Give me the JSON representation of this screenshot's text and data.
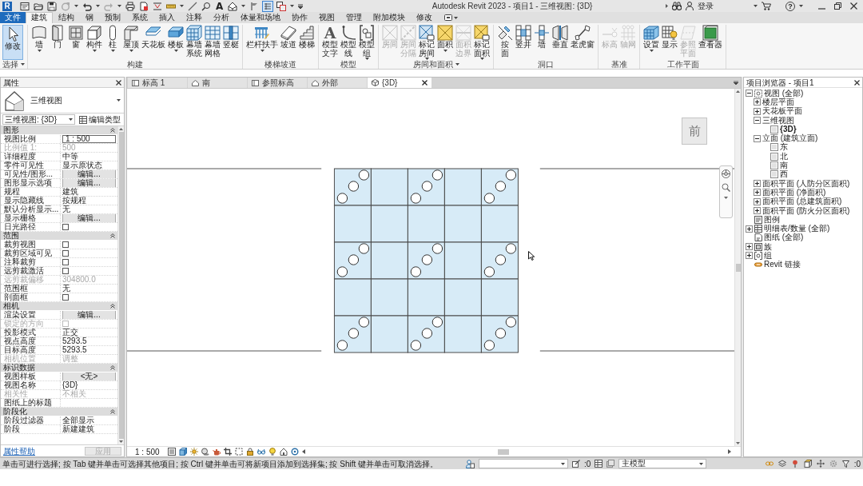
{
  "title_bar": {
    "logo": "R",
    "text_tool": "A",
    "toggle_on": true,
    "title": "Autodesk Revit 2023 - 项目1 - 三维视图: {3D}",
    "user": "登录",
    "help": "?"
  },
  "menu_tabs": [
    {
      "label": "文件",
      "kind": "file",
      "selected": false
    },
    {
      "label": "建筑",
      "kind": "tab",
      "selected": true
    },
    {
      "label": "结构",
      "kind": "tab",
      "selected": false
    },
    {
      "label": "钢",
      "kind": "tab",
      "selected": false
    },
    {
      "label": "预制",
      "kind": "tab",
      "selected": false
    },
    {
      "label": "系统",
      "kind": "tab",
      "selected": false
    },
    {
      "label": "插入",
      "kind": "tab",
      "selected": false
    },
    {
      "label": "注释",
      "kind": "tab",
      "selected": false
    },
    {
      "label": "分析",
      "kind": "tab",
      "selected": false
    },
    {
      "label": "体量和场地",
      "kind": "tab",
      "selected": false
    },
    {
      "label": "协作",
      "kind": "tab",
      "selected": false
    },
    {
      "label": "视图",
      "kind": "tab",
      "selected": false
    },
    {
      "label": "管理",
      "kind": "tab",
      "selected": false
    },
    {
      "label": "附加模块",
      "kind": "tab",
      "selected": false
    },
    {
      "label": "修改",
      "kind": "tab",
      "selected": false
    }
  ],
  "ribbon_groups": [
    {
      "label": "选择",
      "dropdown": true,
      "buttons": [
        {
          "label": "修改",
          "selected": true,
          "disabled": false,
          "dropdown": false
        }
      ]
    },
    {
      "label": "构建",
      "dropdown": false,
      "buttons": [
        {
          "label": "墙",
          "disabled": false,
          "dropdown": true
        },
        {
          "label": "门",
          "disabled": false,
          "dropdown": false
        },
        {
          "label": "窗",
          "disabled": false,
          "dropdown": false
        },
        {
          "label": "构件",
          "disabled": false,
          "dropdown": true
        },
        {
          "label": "柱",
          "disabled": false,
          "dropdown": true
        },
        {
          "label": "屋顶",
          "disabled": false,
          "dropdown": true
        },
        {
          "label": "天花板",
          "disabled": false,
          "dropdown": false
        },
        {
          "label": "楼板",
          "disabled": false,
          "dropdown": true
        },
        {
          "label": "幕墙系统",
          "disabled": false,
          "dropdown": false,
          "stacked": true
        },
        {
          "label": "幕墙网格",
          "disabled": false,
          "dropdown": false,
          "stacked": true
        },
        {
          "label": "竖梃",
          "disabled": false,
          "dropdown": false
        }
      ]
    },
    {
      "label": "楼梯坡道",
      "dropdown": false,
      "buttons": [
        {
          "label": "栏杆扶手",
          "disabled": false,
          "dropdown": true
        },
        {
          "label": "坡道",
          "disabled": false,
          "dropdown": false
        },
        {
          "label": "楼梯",
          "disabled": false,
          "dropdown": false
        }
      ]
    },
    {
      "label": "模型",
      "dropdown": false,
      "buttons": [
        {
          "label": "模型文字",
          "glyph": "A",
          "disabled": false,
          "dropdown": false,
          "stacked": true
        },
        {
          "label": "模型线",
          "disabled": false,
          "dropdown": false,
          "stacked": true
        },
        {
          "label": "模型组",
          "disabled": false,
          "dropdown": true,
          "stacked": true
        }
      ]
    },
    {
      "label": "房间和面积",
      "dropdown": true,
      "buttons": [
        {
          "label": "房间",
          "disabled": true,
          "dropdown": false
        },
        {
          "label": "房间分隔",
          "disabled": true,
          "dropdown": false,
          "stacked": true
        },
        {
          "label": "标记房间",
          "disabled": false,
          "dropdown": true,
          "stacked": true
        },
        {
          "label": "面积",
          "disabled": false,
          "dropdown": true
        },
        {
          "label": "面积边界",
          "disabled": true,
          "dropdown": false,
          "stacked": true
        },
        {
          "label": "标记面积",
          "disabled": false,
          "dropdown": true,
          "stacked": true
        }
      ]
    },
    {
      "label": "洞口",
      "dropdown": false,
      "buttons": [
        {
          "label": "按面",
          "disabled": false,
          "dropdown": false,
          "stacked": true
        },
        {
          "label": "竖井",
          "disabled": false,
          "dropdown": false
        },
        {
          "label": "墙",
          "disabled": false,
          "dropdown": false
        },
        {
          "label": "垂直",
          "disabled": false,
          "dropdown": false
        },
        {
          "label": "老虎窗",
          "disabled": false,
          "dropdown": false
        }
      ]
    },
    {
      "label": "基准",
      "dropdown": false,
      "buttons": [
        {
          "label": "标高",
          "disabled": true,
          "dropdown": false
        },
        {
          "label": "轴网",
          "disabled": true,
          "dropdown": false
        }
      ]
    },
    {
      "label": "工作平面",
      "dropdown": false,
      "buttons": [
        {
          "label": "设置",
          "disabled": false,
          "dropdown": true
        },
        {
          "label": "显示",
          "disabled": false,
          "dropdown": false
        },
        {
          "label": "参照平面",
          "disabled": true,
          "dropdown": false,
          "stacked": true
        },
        {
          "label": "查看器",
          "disabled": false,
          "dropdown": false
        }
      ]
    }
  ],
  "properties": {
    "title": "属性",
    "type_name": "三维视图",
    "selector": "三维视图: {3D}",
    "edit_type": "编辑类型",
    "sections": [
      {
        "label": "图形",
        "expanded": true,
        "rows": [
          {
            "name": "视图比例",
            "kind": "input",
            "value": "1 : 500",
            "disabled": false
          },
          {
            "name": "比例值 1:",
            "kind": "text",
            "value": "500",
            "disabled": true
          },
          {
            "name": "详细程度",
            "kind": "text",
            "value": "中等",
            "disabled": false
          },
          {
            "name": "零件可见性",
            "kind": "text",
            "value": "显示原状态",
            "disabled": false
          },
          {
            "name": "可见性/图形...",
            "kind": "button",
            "value": "编辑...",
            "disabled": false
          },
          {
            "name": "图形显示选项",
            "kind": "button",
            "value": "编辑...",
            "disabled": false
          },
          {
            "name": "规程",
            "kind": "text",
            "value": "建筑",
            "disabled": false
          },
          {
            "name": "显示隐藏线",
            "kind": "text",
            "value": "按规程",
            "disabled": false
          },
          {
            "name": "默认分析显示...",
            "kind": "text",
            "value": "无",
            "disabled": false
          },
          {
            "name": "显示栅格",
            "kind": "button",
            "value": "编辑...",
            "disabled": false
          },
          {
            "name": "日光路径",
            "kind": "checkbox",
            "checked": false,
            "disabled": false
          }
        ]
      },
      {
        "label": "范围",
        "expanded": true,
        "rows": [
          {
            "name": "裁剪视图",
            "kind": "checkbox",
            "checked": false,
            "disabled": false
          },
          {
            "name": "裁剪区域可见",
            "kind": "checkbox",
            "checked": false,
            "disabled": false
          },
          {
            "name": "注释裁剪",
            "kind": "checkbox",
            "checked": false,
            "disabled": false
          },
          {
            "name": "远剪裁激活",
            "kind": "checkbox",
            "checked": false,
            "disabled": false
          },
          {
            "name": "远剪裁偏移",
            "kind": "text",
            "value": "304800.0",
            "disabled": true
          },
          {
            "name": "范围框",
            "kind": "text",
            "value": "无",
            "disabled": false
          },
          {
            "name": "剖面框",
            "kind": "checkbox",
            "checked": false,
            "disabled": false
          }
        ]
      },
      {
        "label": "相机",
        "expanded": true,
        "rows": [
          {
            "name": "渲染设置",
            "kind": "button",
            "value": "编辑...",
            "disabled": false
          },
          {
            "name": "锁定的方向",
            "kind": "checkbox",
            "checked": false,
            "disabled": true
          },
          {
            "name": "投影模式",
            "kind": "text",
            "value": "正交",
            "disabled": false
          },
          {
            "name": "视点高度",
            "kind": "text",
            "value": "5293.5",
            "disabled": false
          },
          {
            "name": "目标高度",
            "kind": "text",
            "value": "5293.5",
            "disabled": false
          },
          {
            "name": "相机位置",
            "kind": "text",
            "value": "调整",
            "disabled": true
          }
        ]
      },
      {
        "label": "标识数据",
        "expanded": true,
        "rows": [
          {
            "name": "视图样板",
            "kind": "button",
            "value": "<无>",
            "disabled": false
          },
          {
            "name": "视图名称",
            "kind": "text",
            "value": "{3D}",
            "disabled": false
          },
          {
            "name": "相关性",
            "kind": "text",
            "value": "不相关",
            "disabled": true
          },
          {
            "name": "图纸上的标题",
            "kind": "text",
            "disabled": false
          }
        ]
      },
      {
        "label": "阶段化",
        "expanded": true,
        "rows": [
          {
            "name": "阶段过滤器",
            "kind": "text",
            "value": "全部显示",
            "disabled": false
          },
          {
            "name": "阶段",
            "kind": "text",
            "value": "新建建筑",
            "disabled": false
          }
        ]
      }
    ],
    "help_link": "属性帮助",
    "apply": {
      "label": "应用",
      "disabled": true
    }
  },
  "view_tabs": [
    {
      "label": "标高 1",
      "kind": "plan",
      "selected": false
    },
    {
      "label": "南",
      "kind": "elevation",
      "selected": false
    },
    {
      "label": "参照标高",
      "kind": "plan",
      "selected": false
    },
    {
      "label": "外部",
      "kind": "elevation",
      "selected": false
    },
    {
      "label": "{3D}",
      "kind": "model",
      "selected": true
    }
  ],
  "view_cube": {
    "face": "前"
  },
  "view_control": {
    "scale": "1 : 500"
  },
  "project_browser": {
    "title": "项目浏览器 - 项目1",
    "tree": [
      {
        "label": "视图 (全部)",
        "kind": "views",
        "expanded": true,
        "selected": false,
        "children": [
          {
            "label": "楼层平面",
            "expanded": false,
            "selected": false
          },
          {
            "label": "天花板平面",
            "expanded": false,
            "selected": false
          },
          {
            "label": "三维视图",
            "expanded": true,
            "selected": false,
            "children": [
              {
                "label": "{3D}",
                "kind": "view",
                "selected": true
              }
            ]
          },
          {
            "label": "立面 (建筑立面)",
            "expanded": true,
            "selected": false,
            "children": [
              {
                "label": "东",
                "kind": "view",
                "selected": false
              },
              {
                "label": "北",
                "kind": "view",
                "selected": false
              },
              {
                "label": "南",
                "kind": "view",
                "selected": false
              },
              {
                "label": "西",
                "kind": "view",
                "selected": false
              }
            ]
          },
          {
            "label": "面积平面 (人防分区面积)",
            "expanded": false,
            "selected": false
          },
          {
            "label": "面积平面 (净面积)",
            "expanded": false,
            "selected": false
          },
          {
            "label": "面积平面 (总建筑面积)",
            "expanded": false,
            "selected": false
          },
          {
            "label": "面积平面 (防火分区面积)",
            "expanded": false,
            "selected": false
          }
        ]
      },
      {
        "label": "图例",
        "kind": "legend",
        "selected": false
      },
      {
        "label": "明细表/数量 (全部)",
        "kind": "schedule",
        "expanded": false,
        "selected": false
      },
      {
        "label": "图纸 (全部)",
        "kind": "sheet",
        "selected": false
      },
      {
        "label": "族",
        "kind": "family",
        "expanded": false,
        "selected": false
      },
      {
        "label": "组",
        "kind": "group",
        "expanded": false,
        "selected": false
      },
      {
        "label": "Revit 链接",
        "kind": "link",
        "selected": false
      }
    ]
  },
  "status_bar": {
    "message": "单击可进行选择; 按 Tab 键并单击可选择其他项目; 按 Ctrl 键并单击可将新项目添加到选择集; 按 Shift 键并单击可取消选择。",
    "editable_count": ":0",
    "model": "主模型",
    "filter_count": ":0"
  }
}
